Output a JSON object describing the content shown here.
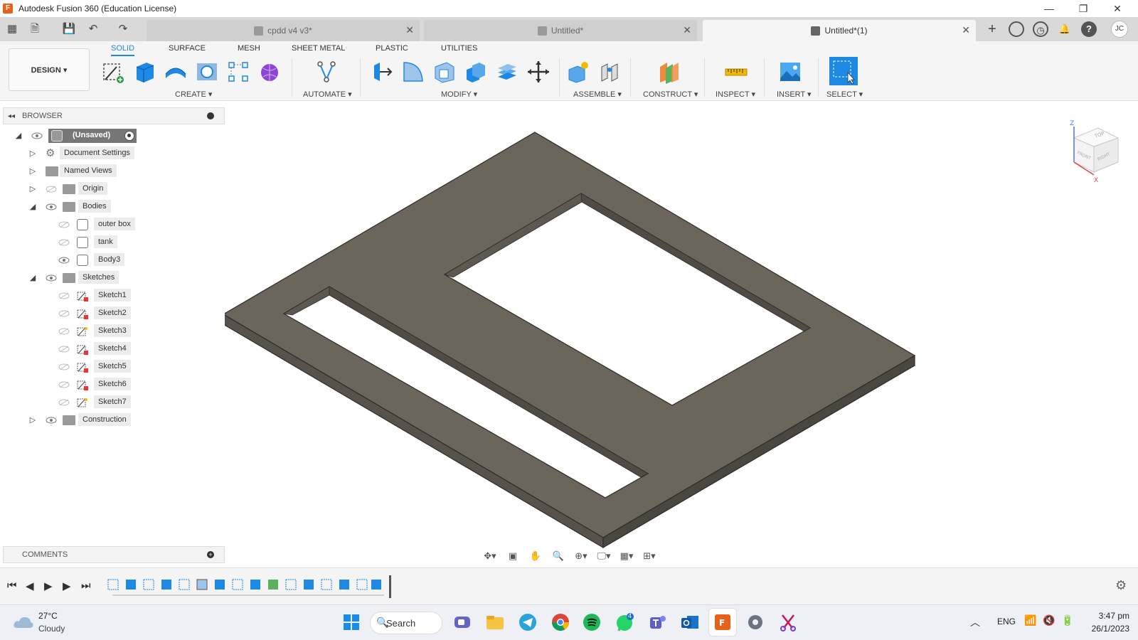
{
  "window": {
    "title": "Autodesk Fusion 360 (Education License)",
    "minimize": "—",
    "maximize": "❐",
    "close": "✕"
  },
  "tabs": [
    {
      "label": "cpdd v4 v3*",
      "active": false
    },
    {
      "label": "Untitled*",
      "active": false
    },
    {
      "label": "Untitled*(1)",
      "active": true
    }
  ],
  "user_initials": "JC",
  "workspace": {
    "design_label": "DESIGN ▾",
    "tabs": [
      "SOLID",
      "SURFACE",
      "MESH",
      "SHEET METAL",
      "PLASTIC",
      "UTILITIES"
    ],
    "active_tab": "SOLID",
    "groups": [
      "CREATE ▾",
      "AUTOMATE ▾",
      "MODIFY ▾",
      "ASSEMBLE ▾",
      "CONSTRUCT ▾",
      "INSPECT ▾",
      "INSERT ▾",
      "SELECT ▾"
    ]
  },
  "browser": {
    "title": "BROWSER",
    "root": "(Unsaved)",
    "items": [
      {
        "label": "Document Settings"
      },
      {
        "label": "Named Views"
      },
      {
        "label": "Origin"
      },
      {
        "label": "Bodies"
      },
      {
        "label": "outer box"
      },
      {
        "label": "tank"
      },
      {
        "label": "Body3"
      },
      {
        "label": "Sketches"
      },
      {
        "label": "Sketch1"
      },
      {
        "label": "Sketch2"
      },
      {
        "label": "Sketch3"
      },
      {
        "label": "Sketch4"
      },
      {
        "label": "Sketch5"
      },
      {
        "label": "Sketch6"
      },
      {
        "label": "Sketch7"
      },
      {
        "label": "Construction"
      }
    ]
  },
  "comments": {
    "title": "COMMENTS"
  },
  "viewcube": {
    "top": "TOP",
    "front": "FRONT",
    "right": "RIGHT"
  },
  "taskbar": {
    "weather_temp": "27°C",
    "weather_desc": "Cloudy",
    "search_label": "Search",
    "whatsapp_badge": "4",
    "lang": "ENG",
    "time": "3:47 pm",
    "date": "26/1/2023"
  },
  "colors": {
    "body": "#6b655c",
    "accent": "#1e88e5",
    "fusion_orange": "#e8611a"
  }
}
